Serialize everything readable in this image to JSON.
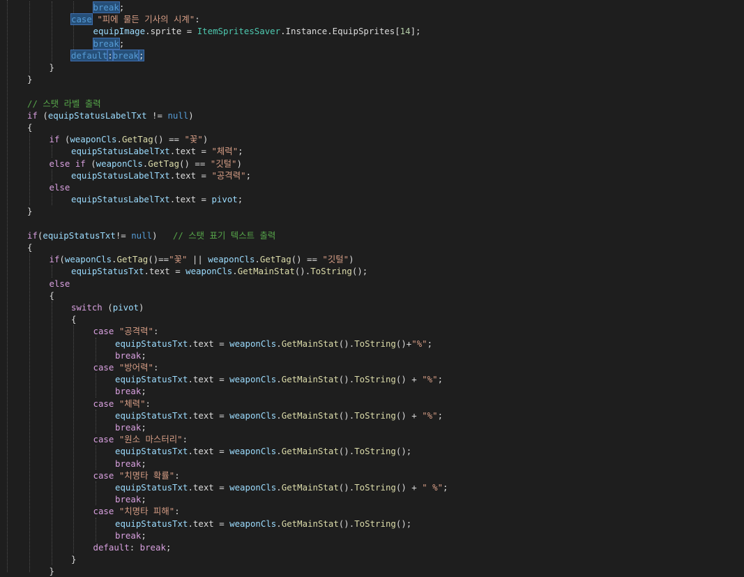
{
  "theme": {
    "background": "#1e1e1e",
    "default": "#dcdcdc",
    "keyword": "#569cd6",
    "control": "#d8a0df",
    "string": "#d69d85",
    "comment": "#57a64a",
    "type": "#4ec9b0",
    "identifier": "#9cdcfe",
    "method": "#dcdcaa",
    "number": "#b5cea8",
    "highlight": "#264f78"
  },
  "lines": [
    {
      "indent": 4,
      "tokens": [
        [
          "break",
          "kw hl"
        ],
        [
          ";",
          "punc"
        ]
      ]
    },
    {
      "indent": 3,
      "tokens": [
        [
          "case",
          "kw hl"
        ],
        [
          " ",
          "punc"
        ],
        [
          "\"피에 물든 기사의 시계\"",
          "str"
        ],
        [
          ":",
          "punc"
        ]
      ]
    },
    {
      "indent": 4,
      "tokens": [
        [
          "equipImage",
          "id"
        ],
        [
          ".sprite = ",
          "punc"
        ],
        [
          "ItemSpritesSaver",
          "typ"
        ],
        [
          ".Instance.EquipSprites[",
          "punc"
        ],
        [
          "14",
          "num"
        ],
        [
          "];",
          "punc"
        ]
      ]
    },
    {
      "indent": 4,
      "tokens": [
        [
          "break",
          "kw hl"
        ],
        [
          ";",
          "punc"
        ]
      ]
    },
    {
      "indent": 3,
      "tokens": [
        [
          "default",
          "kw hl"
        ],
        [
          ":",
          "punc hl"
        ],
        [
          "break",
          "kw hl"
        ],
        [
          ";",
          "punc hl"
        ]
      ]
    },
    {
      "indent": 2,
      "tokens": [
        [
          "}",
          "punc"
        ]
      ]
    },
    {
      "indent": 1,
      "tokens": [
        [
          "}",
          "punc"
        ]
      ]
    },
    {
      "indent": 0,
      "tokens": []
    },
    {
      "indent": 1,
      "tokens": [
        [
          "// 스탯 라벨 출력",
          "cmt"
        ]
      ]
    },
    {
      "indent": 1,
      "tokens": [
        [
          "if",
          "ctl"
        ],
        [
          " (",
          "punc"
        ],
        [
          "equipStatusLabelTxt",
          "id"
        ],
        [
          " != ",
          "punc"
        ],
        [
          "null",
          "kw"
        ],
        [
          ")",
          "punc"
        ]
      ]
    },
    {
      "indent": 1,
      "tokens": [
        [
          "{",
          "punc"
        ]
      ]
    },
    {
      "indent": 2,
      "tokens": [
        [
          "if",
          "ctl"
        ],
        [
          " (",
          "punc"
        ],
        [
          "weaponCls",
          "id"
        ],
        [
          ".",
          "punc"
        ],
        [
          "GetTag",
          "mth"
        ],
        [
          "() == ",
          "punc"
        ],
        [
          "\"꽃\"",
          "str"
        ],
        [
          ")",
          "punc"
        ]
      ]
    },
    {
      "indent": 3,
      "tokens": [
        [
          "equipStatusLabelTxt",
          "id"
        ],
        [
          ".text = ",
          "punc"
        ],
        [
          "\"체력\"",
          "str"
        ],
        [
          ";",
          "punc"
        ]
      ]
    },
    {
      "indent": 2,
      "tokens": [
        [
          "else",
          "ctl"
        ],
        [
          " ",
          "punc"
        ],
        [
          "if",
          "ctl"
        ],
        [
          " (",
          "punc"
        ],
        [
          "weaponCls",
          "id"
        ],
        [
          ".",
          "punc"
        ],
        [
          "GetTag",
          "mth"
        ],
        [
          "() == ",
          "punc"
        ],
        [
          "\"깃털\"",
          "str"
        ],
        [
          ")",
          "punc"
        ]
      ]
    },
    {
      "indent": 3,
      "tokens": [
        [
          "equipStatusLabelTxt",
          "id"
        ],
        [
          ".text = ",
          "punc"
        ],
        [
          "\"공격력\"",
          "str"
        ],
        [
          ";",
          "punc"
        ]
      ]
    },
    {
      "indent": 2,
      "tokens": [
        [
          "else",
          "ctl"
        ]
      ]
    },
    {
      "indent": 3,
      "tokens": [
        [
          "equipStatusLabelTxt",
          "id"
        ],
        [
          ".text = ",
          "punc"
        ],
        [
          "pivot",
          "id"
        ],
        [
          ";",
          "punc"
        ]
      ]
    },
    {
      "indent": 1,
      "tokens": [
        [
          "}",
          "punc"
        ]
      ]
    },
    {
      "indent": 0,
      "tokens": []
    },
    {
      "indent": 1,
      "tokens": [
        [
          "if",
          "ctl"
        ],
        [
          "(",
          "punc"
        ],
        [
          "equipStatusTxt",
          "id"
        ],
        [
          "!= ",
          "punc"
        ],
        [
          "null",
          "kw"
        ],
        [
          ")   ",
          "punc"
        ],
        [
          "// 스탯 표기 텍스트 출력",
          "cmt"
        ]
      ]
    },
    {
      "indent": 1,
      "tokens": [
        [
          "{",
          "punc"
        ]
      ]
    },
    {
      "indent": 2,
      "tokens": [
        [
          "if",
          "ctl"
        ],
        [
          "(",
          "punc"
        ],
        [
          "weaponCls",
          "id"
        ],
        [
          ".",
          "punc"
        ],
        [
          "GetTag",
          "mth"
        ],
        [
          "()==",
          "punc"
        ],
        [
          "\"꽃\"",
          "str"
        ],
        [
          " || ",
          "punc"
        ],
        [
          "weaponCls",
          "id"
        ],
        [
          ".",
          "punc"
        ],
        [
          "GetTag",
          "mth"
        ],
        [
          "() == ",
          "punc"
        ],
        [
          "\"깃털\"",
          "str"
        ],
        [
          ")",
          "punc"
        ]
      ]
    },
    {
      "indent": 3,
      "tokens": [
        [
          "equipStatusTxt",
          "id"
        ],
        [
          ".text = ",
          "punc"
        ],
        [
          "weaponCls",
          "id"
        ],
        [
          ".",
          "punc"
        ],
        [
          "GetMainStat",
          "mth"
        ],
        [
          "().",
          "punc"
        ],
        [
          "ToString",
          "mth"
        ],
        [
          "();",
          "punc"
        ]
      ]
    },
    {
      "indent": 2,
      "tokens": [
        [
          "else",
          "ctl"
        ]
      ]
    },
    {
      "indent": 2,
      "tokens": [
        [
          "{",
          "punc"
        ]
      ]
    },
    {
      "indent": 3,
      "tokens": [
        [
          "switch",
          "ctl"
        ],
        [
          " (",
          "punc"
        ],
        [
          "pivot",
          "id"
        ],
        [
          ")",
          "punc"
        ]
      ]
    },
    {
      "indent": 3,
      "tokens": [
        [
          "{",
          "punc"
        ]
      ]
    },
    {
      "indent": 4,
      "tokens": [
        [
          "case",
          "ctl"
        ],
        [
          " ",
          "punc"
        ],
        [
          "\"공격력\"",
          "str"
        ],
        [
          ":",
          "punc"
        ]
      ]
    },
    {
      "indent": 5,
      "tokens": [
        [
          "equipStatusTxt",
          "id"
        ],
        [
          ".text = ",
          "punc"
        ],
        [
          "weaponCls",
          "id"
        ],
        [
          ".",
          "punc"
        ],
        [
          "GetMainStat",
          "mth"
        ],
        [
          "().",
          "punc"
        ],
        [
          "ToString",
          "mth"
        ],
        [
          "()+",
          "punc"
        ],
        [
          "\"%\"",
          "str"
        ],
        [
          ";",
          "punc"
        ]
      ]
    },
    {
      "indent": 5,
      "tokens": [
        [
          "break",
          "ctl"
        ],
        [
          ";",
          "punc"
        ]
      ]
    },
    {
      "indent": 4,
      "tokens": [
        [
          "case",
          "ctl"
        ],
        [
          " ",
          "punc"
        ],
        [
          "\"방어력\"",
          "str"
        ],
        [
          ":",
          "punc"
        ]
      ]
    },
    {
      "indent": 5,
      "tokens": [
        [
          "equipStatusTxt",
          "id"
        ],
        [
          ".text = ",
          "punc"
        ],
        [
          "weaponCls",
          "id"
        ],
        [
          ".",
          "punc"
        ],
        [
          "GetMainStat",
          "mth"
        ],
        [
          "().",
          "punc"
        ],
        [
          "ToString",
          "mth"
        ],
        [
          "() + ",
          "punc"
        ],
        [
          "\"%\"",
          "str"
        ],
        [
          ";",
          "punc"
        ]
      ]
    },
    {
      "indent": 5,
      "tokens": [
        [
          "break",
          "ctl"
        ],
        [
          ";",
          "punc"
        ]
      ]
    },
    {
      "indent": 4,
      "tokens": [
        [
          "case",
          "ctl"
        ],
        [
          " ",
          "punc"
        ],
        [
          "\"체력\"",
          "str"
        ],
        [
          ":",
          "punc"
        ]
      ]
    },
    {
      "indent": 5,
      "tokens": [
        [
          "equipStatusTxt",
          "id"
        ],
        [
          ".text = ",
          "punc"
        ],
        [
          "weaponCls",
          "id"
        ],
        [
          ".",
          "punc"
        ],
        [
          "GetMainStat",
          "mth"
        ],
        [
          "().",
          "punc"
        ],
        [
          "ToString",
          "mth"
        ],
        [
          "() + ",
          "punc"
        ],
        [
          "\"%\"",
          "str"
        ],
        [
          ";",
          "punc"
        ]
      ]
    },
    {
      "indent": 5,
      "tokens": [
        [
          "break",
          "ctl"
        ],
        [
          ";",
          "punc"
        ]
      ]
    },
    {
      "indent": 4,
      "tokens": [
        [
          "case",
          "ctl"
        ],
        [
          " ",
          "punc"
        ],
        [
          "\"원소 마스터리\"",
          "str"
        ],
        [
          ":",
          "punc"
        ]
      ]
    },
    {
      "indent": 5,
      "tokens": [
        [
          "equipStatusTxt",
          "id"
        ],
        [
          ".text = ",
          "punc"
        ],
        [
          "weaponCls",
          "id"
        ],
        [
          ".",
          "punc"
        ],
        [
          "GetMainStat",
          "mth"
        ],
        [
          "().",
          "punc"
        ],
        [
          "ToString",
          "mth"
        ],
        [
          "();",
          "punc"
        ]
      ]
    },
    {
      "indent": 5,
      "tokens": [
        [
          "break",
          "ctl"
        ],
        [
          ";",
          "punc"
        ]
      ]
    },
    {
      "indent": 4,
      "tokens": [
        [
          "case",
          "ctl"
        ],
        [
          " ",
          "punc"
        ],
        [
          "\"치명타 확률\"",
          "str"
        ],
        [
          ":",
          "punc"
        ]
      ]
    },
    {
      "indent": 5,
      "tokens": [
        [
          "equipStatusTxt",
          "id"
        ],
        [
          ".text = ",
          "punc"
        ],
        [
          "weaponCls",
          "id"
        ],
        [
          ".",
          "punc"
        ],
        [
          "GetMainStat",
          "mth"
        ],
        [
          "().",
          "punc"
        ],
        [
          "ToString",
          "mth"
        ],
        [
          "() + ",
          "punc"
        ],
        [
          "\" %\"",
          "str"
        ],
        [
          ";",
          "punc"
        ]
      ]
    },
    {
      "indent": 5,
      "tokens": [
        [
          "break",
          "ctl"
        ],
        [
          ";",
          "punc"
        ]
      ]
    },
    {
      "indent": 4,
      "tokens": [
        [
          "case",
          "ctl"
        ],
        [
          " ",
          "punc"
        ],
        [
          "\"치명타 피해\"",
          "str"
        ],
        [
          ":",
          "punc"
        ]
      ]
    },
    {
      "indent": 5,
      "tokens": [
        [
          "equipStatusTxt",
          "id"
        ],
        [
          ".text = ",
          "punc"
        ],
        [
          "weaponCls",
          "id"
        ],
        [
          ".",
          "punc"
        ],
        [
          "GetMainStat",
          "mth"
        ],
        [
          "().",
          "punc"
        ],
        [
          "ToString",
          "mth"
        ],
        [
          "();",
          "punc"
        ]
      ]
    },
    {
      "indent": 5,
      "tokens": [
        [
          "break",
          "ctl"
        ],
        [
          ";",
          "punc"
        ]
      ]
    },
    {
      "indent": 4,
      "tokens": [
        [
          "default",
          "ctl"
        ],
        [
          ": ",
          "punc"
        ],
        [
          "break",
          "ctl"
        ],
        [
          ";",
          "punc"
        ]
      ]
    },
    {
      "indent": 3,
      "tokens": [
        [
          "}",
          "punc"
        ]
      ]
    },
    {
      "indent": 2,
      "tokens": [
        [
          "}",
          "punc"
        ]
      ]
    }
  ]
}
